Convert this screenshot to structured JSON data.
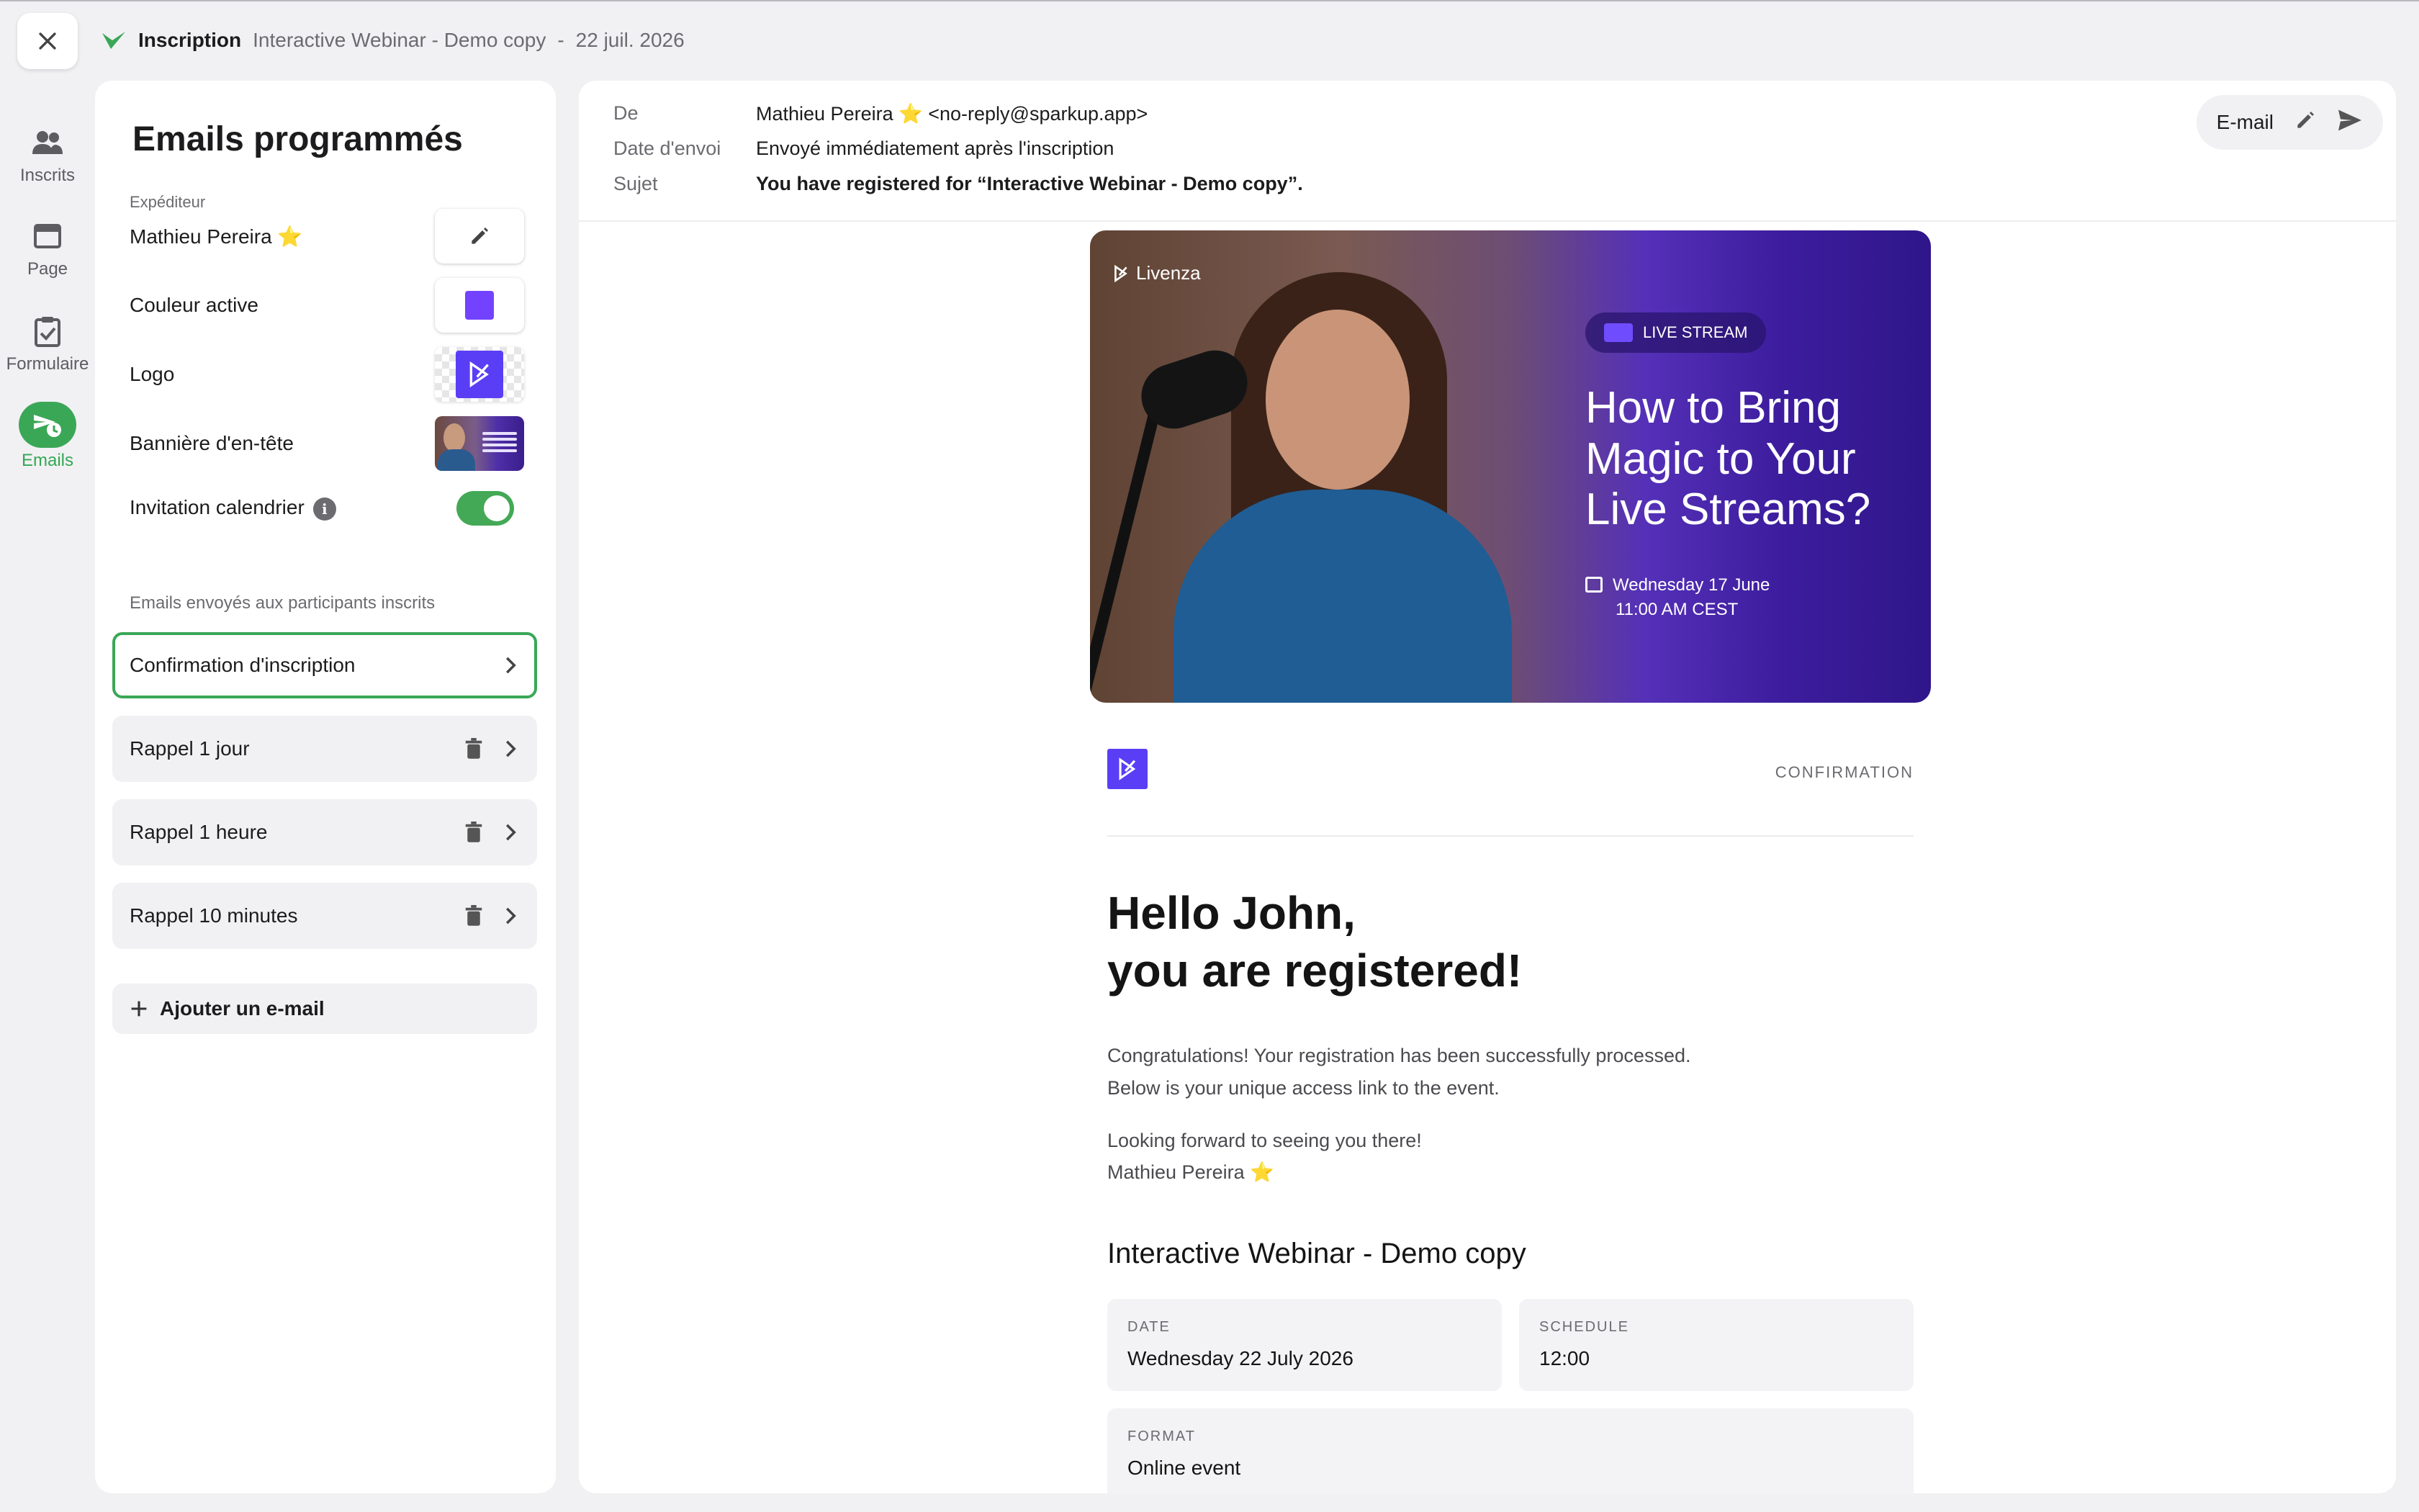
{
  "topbar": {
    "title": "Inscription",
    "event": "Interactive Webinar - Demo copy",
    "separator": "-",
    "date": "22 juil. 2026"
  },
  "nav": {
    "items": [
      {
        "label": "Inscrits",
        "icon": "people-icon"
      },
      {
        "label": "Page",
        "icon": "window-icon"
      },
      {
        "label": "Formulaire",
        "icon": "clipboard-check-icon"
      },
      {
        "label": "Emails",
        "icon": "scheduled-email-icon",
        "active": true
      }
    ]
  },
  "panel": {
    "title": "Emails programmés",
    "sender_label": "Expéditeur",
    "sender_name": "Mathieu Pereira ⭐",
    "active_color_label": "Couleur active",
    "active_color": "#7342ff",
    "logo_label": "Logo",
    "banner_label": "Bannière d'en-tête",
    "calendar_label": "Invitation calendrier",
    "calendar_enabled": true,
    "emails_section_label": "Emails envoyés aux participants inscrits",
    "emails": [
      {
        "label": "Confirmation d'inscription",
        "selected": true
      },
      {
        "label": "Rappel 1 jour"
      },
      {
        "label": "Rappel 1 heure"
      },
      {
        "label": "Rappel 10 minutes"
      }
    ],
    "add_label": "Ajouter un e-mail"
  },
  "header": {
    "from_label": "De",
    "from_value": "Mathieu Pereira ⭐ <no-reply@sparkup.app>",
    "date_label": "Date d'envoi",
    "date_value": "Envoyé immédiatement après l'inscription",
    "subject_label": "Sujet",
    "subject_value": "You have registered for “Interactive Webinar - Demo copy”.",
    "action_label": "E-mail"
  },
  "email": {
    "banner": {
      "brand": "Livenza",
      "badge": "LIVE STREAM",
      "headline": "How to Bring Magic to Your Live Streams?",
      "date_line": "Wednesday 17 June",
      "time_line": "11:00 AM CEST"
    },
    "tag": "CONFIRMATION",
    "hello_line1": "Hello John,",
    "hello_line2": "you are registered!",
    "p1_line1": "Congratulations! Your registration has been successfully processed.",
    "p1_line2": "Below is your unique access link to the event.",
    "p2_line1": "Looking forward to seeing you there!",
    "p2_line2": "Mathieu Pereira ⭐",
    "event_title": "Interactive Webinar - Demo copy",
    "cards": {
      "date_key": "DATE",
      "date_value": "Wednesday 22 July 2026",
      "schedule_key": "SCHEDULE",
      "schedule_value": "12:00",
      "format_key": "FORMAT",
      "format_value": "Online event"
    }
  },
  "colors": {
    "accent_green": "#3aa757",
    "brand_purple": "#5a3ef5"
  }
}
